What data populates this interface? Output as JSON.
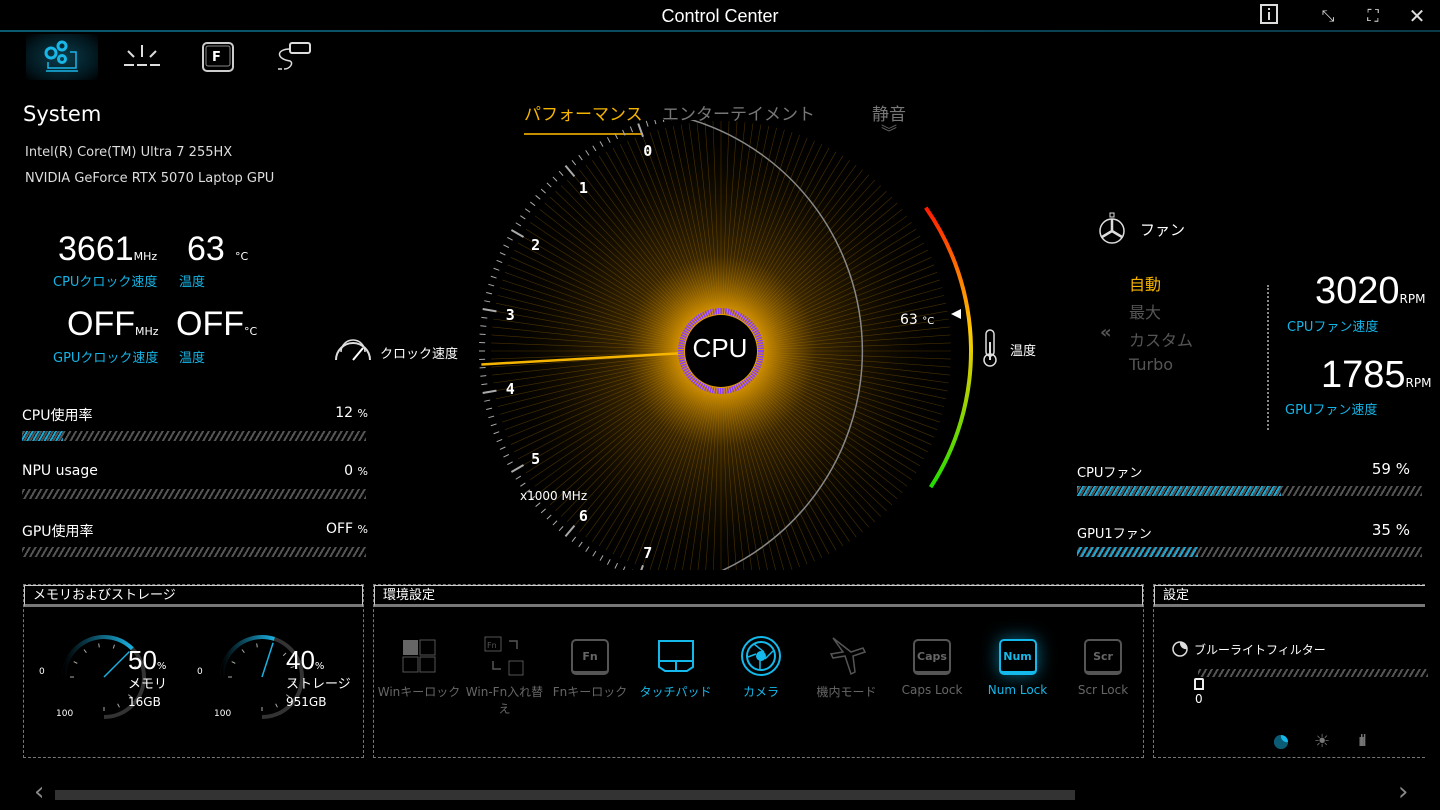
{
  "window": {
    "title": "Control Center",
    "buttons": [
      "info",
      "restore",
      "fullscreen",
      "close"
    ]
  },
  "nav": [
    {
      "icon": "system-gears-icon",
      "active": true
    },
    {
      "icon": "lighting-icon"
    },
    {
      "icon": "function-key-icon"
    },
    {
      "icon": "battery-power-icon"
    }
  ],
  "system": {
    "heading": "System",
    "cpu_name": "Intel(R) Core(TM) Ultra 7 255HX",
    "gpu_name": "NVIDIA GeForce RTX 5070 Laptop GPU",
    "cpu_clock": "3661",
    "cpu_clock_unit": "MHz",
    "cpu_clock_label": "CPUクロック速度",
    "cpu_temp": "63",
    "cpu_temp_unit": "°C",
    "cpu_temp_label": "温度",
    "gpu_clock": "OFF",
    "gpu_clock_unit": "MHz",
    "gpu_clock_label": "GPUクロック速度",
    "gpu_temp": "OFF",
    "gpu_temp_unit": "°C",
    "gpu_temp_label": "温度",
    "usage": [
      {
        "label": "CPU使用率",
        "value": "12",
        "unit": "%",
        "percent": 12
      },
      {
        "label": "NPU usage",
        "value": "0",
        "unit": "%",
        "percent": 0
      },
      {
        "label": "GPU使用率",
        "value": "OFF",
        "unit": "%",
        "percent": 0
      }
    ]
  },
  "modes": {
    "tabs": [
      "パフォーマンス",
      "エンターテイメント",
      "静音"
    ],
    "active": 0
  },
  "gauge": {
    "center_label": "CPU",
    "clock_label": "クロック速度",
    "temp_label": "温度",
    "scale_ticks": [
      "0",
      "1",
      "2",
      "3",
      "4",
      "5",
      "6",
      "7"
    ],
    "scale_unit": "x1000 MHz",
    "clock_value_ghz": 3.661,
    "temp_value": "63",
    "temp_unit": "°C",
    "accent": "#f5b400"
  },
  "fan": {
    "heading": "ファン",
    "modes": [
      "自動",
      "最大",
      "カスタム",
      "Turbo"
    ],
    "active_mode": 0,
    "cpu_rpm": "3020",
    "gpu_rpm": "1785",
    "rpm_unit": "RPM",
    "cpu_rpm_label": "CPUファン速度",
    "gpu_rpm_label": "GPUファン速度",
    "bars": [
      {
        "label": "CPUファン",
        "value": "59 %",
        "percent": 59
      },
      {
        "label": "GPU1ファン",
        "value": "35 %",
        "percent": 35
      }
    ]
  },
  "memory": {
    "heading": "メモリおよびストレージ",
    "gauges": [
      {
        "percent": "50",
        "unit": "%",
        "label": "メモリ",
        "size": "16GB",
        "min": "0",
        "max": "100"
      },
      {
        "percent": "40",
        "unit": "%",
        "label": "ストレージ",
        "size": "951GB",
        "min": "0",
        "max": "100"
      }
    ]
  },
  "env": {
    "heading": "環境設定",
    "items": [
      {
        "label": "Winキーロック",
        "on": false
      },
      {
        "label": "Win-Fn入れ替え",
        "on": false
      },
      {
        "label": "Fnキーロック",
        "on": false,
        "key": "Fn"
      },
      {
        "label": "タッチパッド",
        "on": true
      },
      {
        "label": "カメラ",
        "on": true
      },
      {
        "label": "機内モード",
        "on": false
      },
      {
        "label": "Caps Lock",
        "on": false,
        "key": "Caps"
      },
      {
        "label": "Num Lock",
        "on": true,
        "key": "Num"
      },
      {
        "label": "Scr Lock",
        "on": false,
        "key": "Scr"
      }
    ]
  },
  "settings": {
    "heading": "設定",
    "blue_light_label": "ブルーライトフィルター",
    "blue_light_value": "0"
  }
}
